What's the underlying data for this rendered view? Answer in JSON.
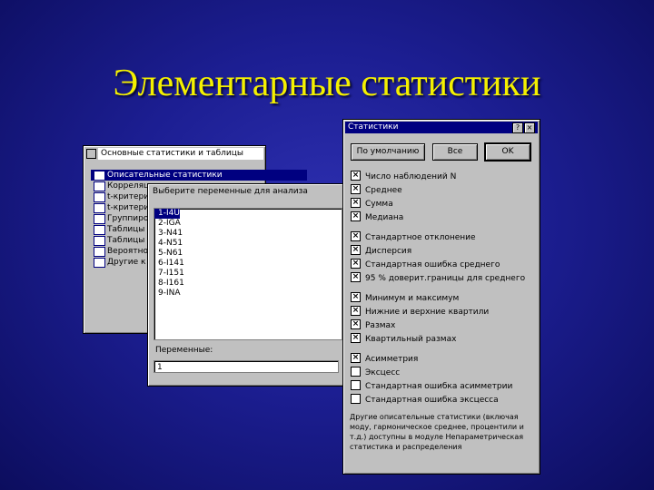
{
  "slide": {
    "title": "Элементарные статистики"
  },
  "win1": {
    "title": "Основные статистики и таблицы",
    "items": [
      {
        "label": "Описательные статистики",
        "selected": true
      },
      {
        "label": "Корреляции"
      },
      {
        "label": "t-критерий"
      },
      {
        "label": "t-критерий"
      },
      {
        "label": "Группиро"
      },
      {
        "label": "Таблицы"
      },
      {
        "label": "Таблицы"
      },
      {
        "label": "Вероятно"
      },
      {
        "label": "Другие к"
      }
    ]
  },
  "win2": {
    "title": "Выберите переменные для анализа",
    "variables": [
      "1-I4U",
      "2-IGA",
      "3-N41",
      "4-N51",
      "5-N61",
      "6-I141",
      "7-I151",
      "8-I161",
      "9-INA"
    ],
    "vars_label": "Переменные:",
    "vars_value": "1"
  },
  "win3": {
    "title": "Статистики",
    "help_btn": "?",
    "close_btn": "×",
    "buttons": {
      "default": "По умолчанию",
      "all": "Все",
      "ok": "OK"
    },
    "options": [
      {
        "label": "Число наблюдений N",
        "checked": true
      },
      {
        "label": "Среднее",
        "checked": true
      },
      {
        "label": "Сумма",
        "checked": true
      },
      {
        "label": "Медиана",
        "checked": true
      },
      {
        "label": "Стандартное отклонение",
        "checked": true
      },
      {
        "label": "Дисперсия",
        "checked": true
      },
      {
        "label": "Стандартная ошибка среднего",
        "checked": true
      },
      {
        "label": "95 % доверит.границы для среднего",
        "checked": true
      },
      {
        "label": "Минимум и максимум",
        "checked": true
      },
      {
        "label": "Нижние и верхние квартили",
        "checked": true
      },
      {
        "label": "Размах",
        "checked": true
      },
      {
        "label": "Квартильный размах",
        "checked": true
      },
      {
        "label": "Асимметрия",
        "checked": true
      },
      {
        "label": "Эксцесс",
        "checked": false
      },
      {
        "label": "Стандартная ошибка асимметрии",
        "checked": false
      },
      {
        "label": "Стандартная ошибка эксцесса",
        "checked": false
      }
    ],
    "check_mark": "×",
    "note": "Другие описательные статистики (включая моду, гармоническое среднее, процентили и т.д.) доступны в модуле Непараметрическая статистика и распределения"
  }
}
